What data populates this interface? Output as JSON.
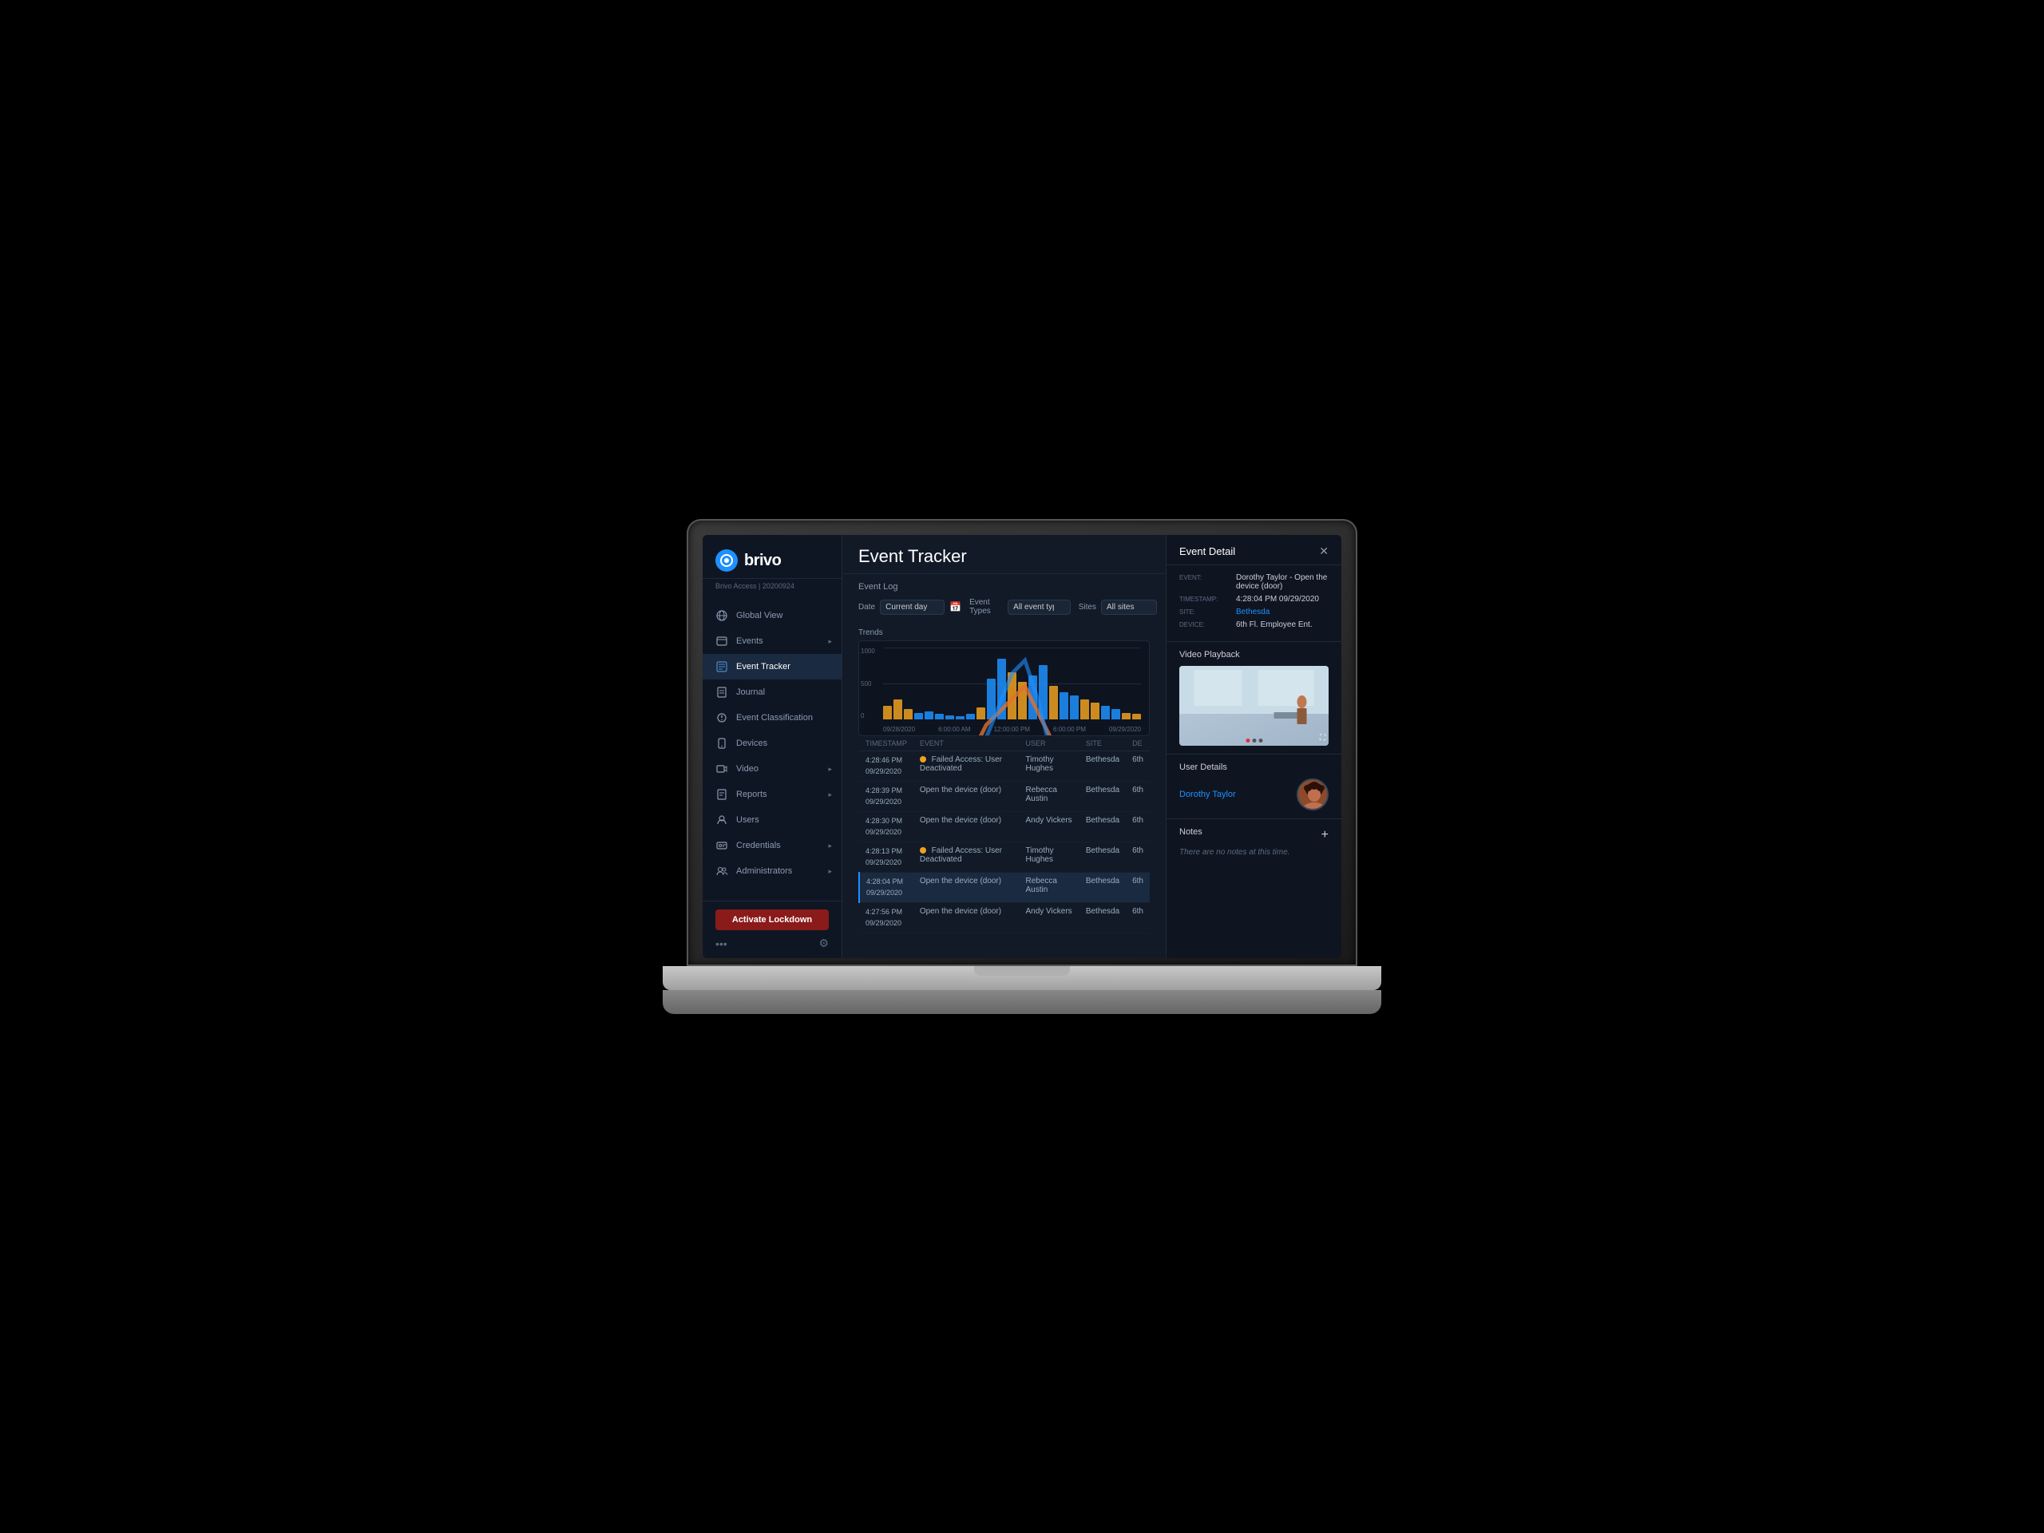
{
  "app": {
    "title": "Event Tracker",
    "brand": "brivo",
    "subtitle": "Brivo Access  |  20200924"
  },
  "sidebar": {
    "items": [
      {
        "id": "global-view",
        "label": "Global View",
        "icon": "🌐",
        "arrow": false
      },
      {
        "id": "events",
        "label": "Events",
        "icon": "🖥",
        "arrow": true
      },
      {
        "id": "event-tracker",
        "label": "Event Tracker",
        "icon": "📋",
        "active": true,
        "arrow": false
      },
      {
        "id": "journal",
        "label": "Journal",
        "icon": "📖",
        "arrow": false
      },
      {
        "id": "event-classification",
        "label": "Event Classification",
        "icon": "💬",
        "arrow": false
      },
      {
        "id": "devices",
        "label": "Devices",
        "icon": "📱",
        "arrow": false
      },
      {
        "id": "video",
        "label": "Video",
        "icon": "📹",
        "arrow": true
      },
      {
        "id": "reports",
        "label": "Reports",
        "icon": "📄",
        "arrow": true
      },
      {
        "id": "users",
        "label": "Users",
        "icon": "👤",
        "arrow": false
      },
      {
        "id": "credentials",
        "label": "Credentials",
        "icon": "🪪",
        "arrow": true
      },
      {
        "id": "administrators",
        "label": "Administrators",
        "icon": "👥",
        "arrow": true
      }
    ],
    "lockdown_label": "Activate Lockdown"
  },
  "filters": {
    "date_label": "Date",
    "date_value": "Current day",
    "event_types_label": "Event Types",
    "event_types_value": "All event types",
    "sites_label": "Sites",
    "sites_value": "All sites"
  },
  "chart": {
    "title": "Trends",
    "y_labels": [
      "1000",
      "500",
      "0"
    ],
    "x_labels": [
      "09/28/2020",
      "6:00:00 AM",
      "12:00:00 PM",
      "6:00:00 PM",
      "09/29/2020"
    ],
    "bars": [
      {
        "height": 20,
        "color": "#f0a020"
      },
      {
        "height": 30,
        "color": "#f0a020"
      },
      {
        "height": 15,
        "color": "#f0a020"
      },
      {
        "height": 10,
        "color": "#1e90ff"
      },
      {
        "height": 12,
        "color": "#1e90ff"
      },
      {
        "height": 8,
        "color": "#1e90ff"
      },
      {
        "height": 6,
        "color": "#1e90ff"
      },
      {
        "height": 5,
        "color": "#1e90ff"
      },
      {
        "height": 8,
        "color": "#1e90ff"
      },
      {
        "height": 18,
        "color": "#f0a020"
      },
      {
        "height": 60,
        "color": "#1e90ff"
      },
      {
        "height": 90,
        "color": "#1e90ff"
      },
      {
        "height": 70,
        "color": "#f0a020"
      },
      {
        "height": 55,
        "color": "#f0a020"
      },
      {
        "height": 65,
        "color": "#1e90ff"
      },
      {
        "height": 80,
        "color": "#1e90ff"
      },
      {
        "height": 50,
        "color": "#f0a020"
      },
      {
        "height": 40,
        "color": "#1e90ff"
      },
      {
        "height": 35,
        "color": "#1e90ff"
      },
      {
        "height": 30,
        "color": "#f0a020"
      },
      {
        "height": 25,
        "color": "#f0a020"
      },
      {
        "height": 20,
        "color": "#1e90ff"
      },
      {
        "height": 15,
        "color": "#1e90ff"
      },
      {
        "height": 10,
        "color": "#f0a020"
      },
      {
        "height": 8,
        "color": "#f0a020"
      }
    ]
  },
  "event_log": {
    "label": "Event Log",
    "columns": [
      "Timestamp",
      "Event",
      "User",
      "Site",
      "De"
    ],
    "rows": [
      {
        "timestamp": "4:28:46 PM\n09/29/2020",
        "event": "Failed Access: User Deactivated",
        "event_type": "failed",
        "user": "Timothy Hughes",
        "site": "Bethesda",
        "device": "6th",
        "selected": false
      },
      {
        "timestamp": "4:28:39 PM\n09/29/2020",
        "event": "Open the device (door)",
        "event_type": "normal",
        "user": "Rebecca Austin",
        "site": "Bethesda",
        "device": "6th",
        "selected": false
      },
      {
        "timestamp": "4:28:30 PM\n09/29/2020",
        "event": "Open the device (door)",
        "event_type": "normal",
        "user": "Andy Vickers",
        "site": "Bethesda",
        "device": "6th",
        "selected": false
      },
      {
        "timestamp": "4:28:13 PM\n09/29/2020",
        "event": "Failed Access: User Deactivated",
        "event_type": "failed",
        "user": "Timothy Hughes",
        "site": "Bethesda",
        "device": "6th",
        "selected": false
      },
      {
        "timestamp": "4:28:04 PM\n09/29/2020",
        "event": "Open the device (door)",
        "event_type": "normal",
        "user": "Rebecca Austin",
        "site": "Bethesda",
        "device": "6th",
        "selected": true
      },
      {
        "timestamp": "4:27:56 PM\n09/29/2020",
        "event": "Open the device (door)",
        "event_type": "normal",
        "user": "Andy Vickers",
        "site": "Bethesda",
        "device": "6th",
        "selected": false
      }
    ]
  },
  "event_detail": {
    "panel_title": "Event Detail",
    "event_label": "EVENT:",
    "event_value": "Dorothy Taylor  - Open the device (door)",
    "timestamp_label": "TIMESTAMP:",
    "timestamp_value": "4:28:04 PM 09/29/2020",
    "site_label": "SITE:",
    "site_value": "Bethesda",
    "device_label": "DEVICE:",
    "device_value": "6th Fl. Employee Ent.",
    "video_title": "Video Playback",
    "user_details_title": "User Details",
    "user_name": "Dorothy Taylor",
    "notes_title": "Notes",
    "notes_empty": "There are no notes at this time."
  }
}
